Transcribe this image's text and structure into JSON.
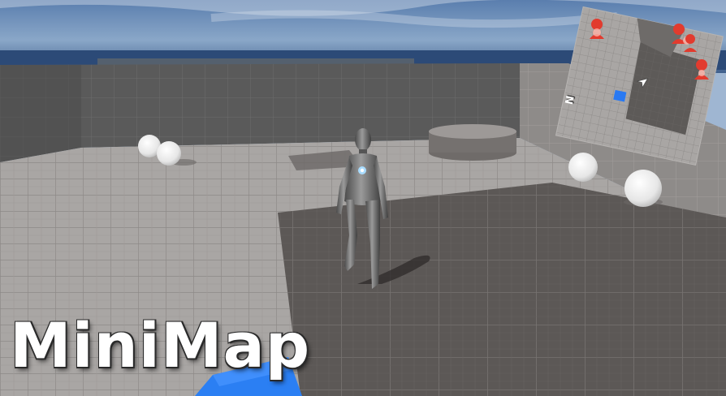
{
  "title": "MiniMap",
  "minimap": {
    "compass_label": "N",
    "enemy_count": 4
  },
  "colors": {
    "sky_top": "#5d7fae",
    "sky_bottom": "#c4d2e2",
    "wall": "#5a5a5a",
    "floor_light": "#a7a4a2",
    "floor_dark": "#5b5755",
    "accent_blue": "#2979f2",
    "enemy_red": "#e23b2e",
    "character": "#6b6b6b",
    "character_glow": "#9fd6ff"
  },
  "icons": [
    "player-arrow-icon",
    "enemy-marker-icon",
    "compass-north-icon"
  ]
}
